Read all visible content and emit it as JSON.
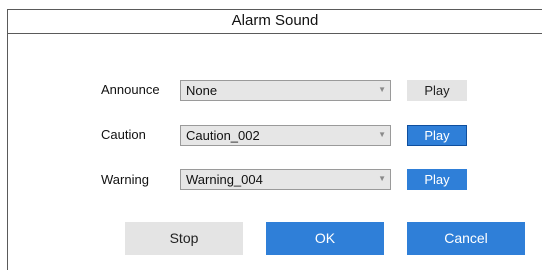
{
  "dialog": {
    "title": "Alarm Sound"
  },
  "rows": [
    {
      "label": "Announce",
      "value": "None",
      "play_label": "Play"
    },
    {
      "label": "Caution",
      "value": "Caution_002",
      "play_label": "Play"
    },
    {
      "label": "Warning",
      "value": "Warning_004",
      "play_label": "Play"
    }
  ],
  "footer": {
    "stop_label": "Stop",
    "ok_label": "OK",
    "cancel_label": "Cancel"
  },
  "icons": {
    "dropdown": "chevron-down-icon"
  },
  "colors": {
    "accent": "#2f7fd8",
    "button_gray": "#e4e4e4",
    "select_bg": "#e6e6e6"
  }
}
